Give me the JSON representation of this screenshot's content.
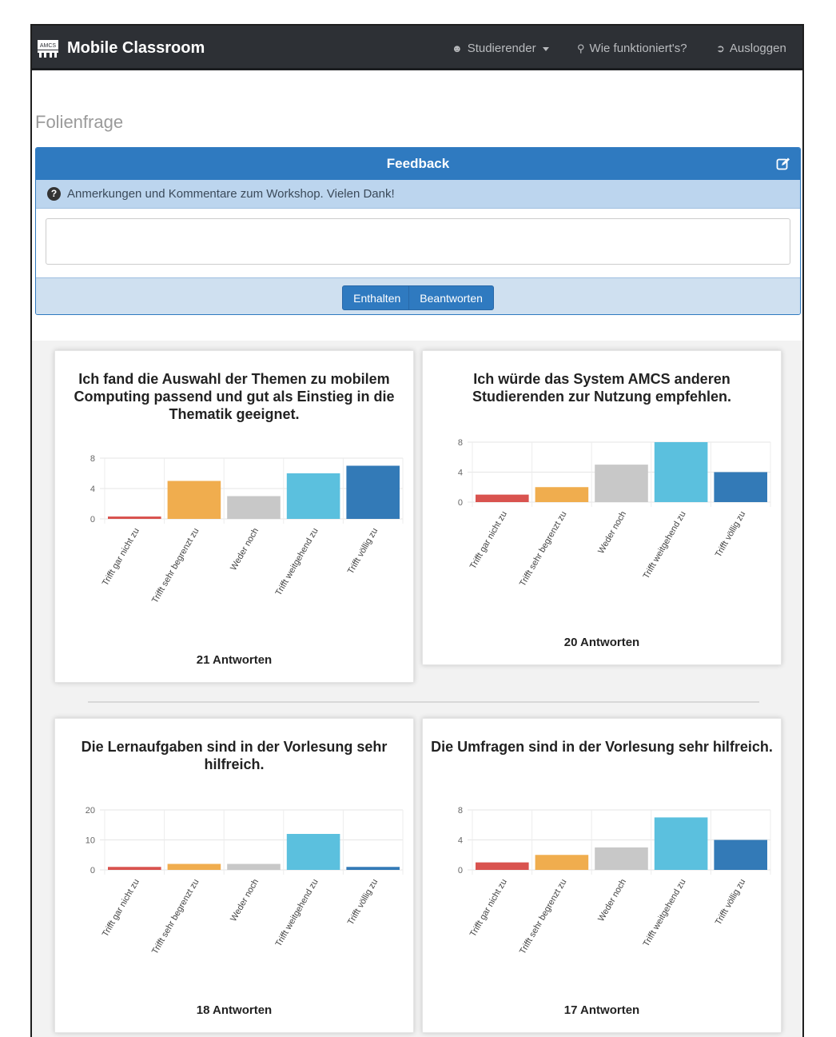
{
  "navbar": {
    "brand": "Mobile Classroom",
    "logo_text": "AMCS",
    "user_label": "Studierender",
    "help_label": "Wie funktioniert's?",
    "logout_label": "Ausloggen"
  },
  "page": {
    "title": "Folienfrage"
  },
  "panel": {
    "header": "Feedback",
    "info": "Anmerkungen und Kommentare zum Workshop. Vielen Dank!",
    "input_value": "",
    "btn_abstain": "Enthalten",
    "btn_answer": "Beantworten"
  },
  "colors": {
    "red": "#d9534f",
    "orange": "#f0ad4e",
    "gray": "#c8c8c8",
    "lightblue": "#5bc0de",
    "blue": "#337ab7",
    "navbar": "#2d3035",
    "primary": "#2f7ac0"
  },
  "chart_data": [
    {
      "type": "bar",
      "title": "Ich fand die Auswahl der Themen zu mobilem Computing passend und gut als Einstieg in die Thematik geeignet.",
      "categories": [
        "Trifft gar nicht zu",
        "Trifft sehr begrenzt zu",
        "Weder noch",
        "Trifft weitgehend zu",
        "Trifft völlig zu"
      ],
      "values": [
        0,
        5,
        3,
        6,
        7
      ],
      "yticks": [
        0,
        4,
        8
      ],
      "ylim": [
        0,
        8
      ],
      "footer": "21 Antworten"
    },
    {
      "type": "bar",
      "title": "Ich würde das System AMCS anderen Studierenden zur Nutzung empfehlen.",
      "categories": [
        "Trifft gar nicht zu",
        "Trifft sehr begrenzt zu",
        "Weder noch",
        "Trifft weitgehend zu",
        "Trifft völlig zu"
      ],
      "values": [
        1,
        2,
        5,
        8,
        4
      ],
      "yticks": [
        0,
        4,
        8
      ],
      "ylim": [
        0,
        8
      ],
      "footer": "20 Antworten"
    },
    {
      "type": "bar",
      "title": "Die Lernaufgaben sind in der Vorlesung sehr hilfreich.",
      "categories": [
        "Trifft gar nicht zu",
        "Trifft sehr begrenzt zu",
        "Weder noch",
        "Trifft weitgehend zu",
        "Trifft völlig zu"
      ],
      "values": [
        1,
        2,
        2,
        12,
        1
      ],
      "yticks": [
        0,
        10,
        20
      ],
      "ylim": [
        0,
        20
      ],
      "footer": "18 Antworten"
    },
    {
      "type": "bar",
      "title": "Die Umfragen sind in der Vorlesung sehr hilfreich.",
      "categories": [
        "Trifft gar nicht zu",
        "Trifft sehr begrenzt zu",
        "Weder noch",
        "Trifft weitgehend zu",
        "Trifft völlig zu"
      ],
      "values": [
        1,
        2,
        3,
        7,
        4
      ],
      "yticks": [
        0,
        4,
        8
      ],
      "ylim": [
        0,
        8
      ],
      "footer": "17 Antworten"
    }
  ]
}
